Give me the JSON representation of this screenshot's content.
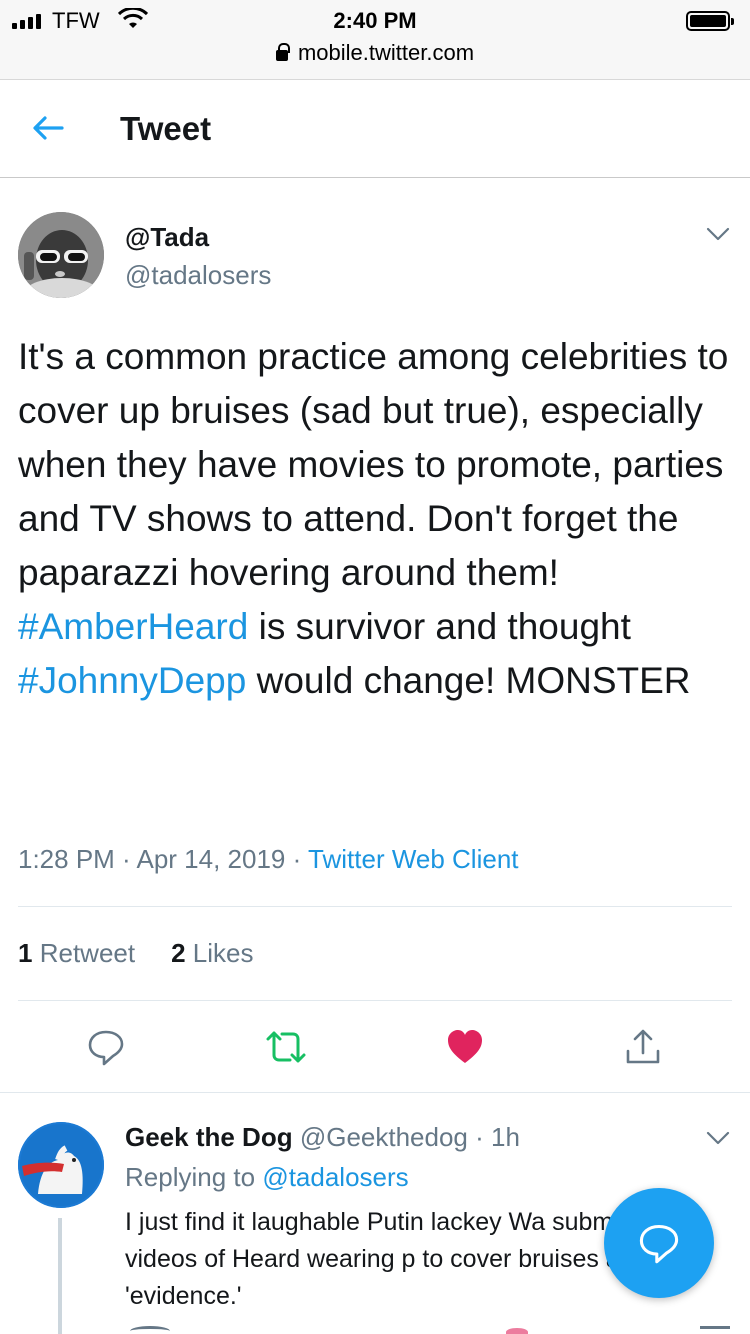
{
  "status_bar": {
    "carrier": "TFW",
    "time": "2:40 PM",
    "url": "mobile.twitter.com"
  },
  "header": {
    "title": "Tweet"
  },
  "tweet": {
    "display_name": "@Tada",
    "handle": "@tadalosers",
    "text_1": "It's a common practice among celebrities to cover up bruises (sad but true), especially when they have movies to promote, parties and TV shows to attend. Don't forget the paparazzi hovering around them! ",
    "hashtag_1": "#AmberHeard",
    "text_2": " is survivor and thought ",
    "hashtag_2": "#JohnnyDepp",
    "text_3": " would change! MONSTER",
    "time": "1:28 PM",
    "date": "Apr 14, 2019",
    "client": "Twitter Web Client",
    "retweet_count": "1",
    "retweet_label": "Retweet",
    "like_count": "2",
    "like_label": "Likes"
  },
  "reply": {
    "display_name": "Geek the Dog",
    "handle": "@Geekthedog",
    "age": "1h",
    "replying_label": "Replying to",
    "replying_to": "@tadalosers",
    "text": "I just find it laughable Putin lackey Wa submitted 87 videos of Heard wearing p to cover bruises as 'evidence.'"
  },
  "colors": {
    "link": "#1b95e0",
    "retweet_active": "#17bf63",
    "like_active": "#e0245e",
    "fab": "#1da1f2"
  },
  "icons": [
    "back-arrow-icon",
    "chevron-down-icon",
    "reply-icon",
    "retweet-icon",
    "heart-icon",
    "share-icon",
    "compose-reply-icon"
  ]
}
